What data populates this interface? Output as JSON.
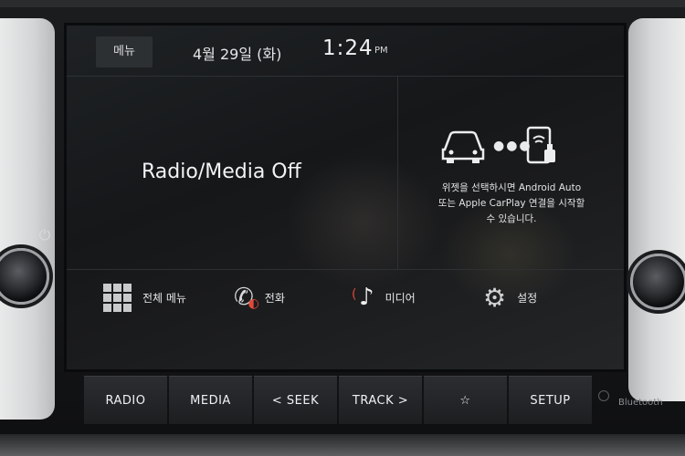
{
  "status_bar": {
    "menu_label": "메뉴",
    "date": "4월 29일 (화)",
    "time": "1:24",
    "ampm": "PM"
  },
  "main": {
    "radio_status": "Radio/Media Off",
    "connect_message_line1": "위젯을 선택하시면 Android Auto",
    "connect_message_line2": "또는 Apple CarPlay 연결을 시작할",
    "connect_message_line3": "수 있습니다."
  },
  "shortcuts": [
    {
      "label": "전체 메뉴",
      "icon": "grid-icon"
    },
    {
      "label": "전화",
      "icon": "phone-icon"
    },
    {
      "label": "미디어",
      "icon": "music-note-icon"
    },
    {
      "label": "설정",
      "icon": "gear-icon"
    }
  ],
  "hardware_buttons": [
    {
      "label": "RADIO"
    },
    {
      "label": "MEDIA"
    },
    {
      "label": "< SEEK"
    },
    {
      "label": "TRACK >"
    },
    {
      "label": "☆"
    },
    {
      "label": "SETUP"
    }
  ],
  "bluetooth_label": "Bluetooth",
  "colors": {
    "accent_red": "#e2483a",
    "screen_bg": "#1a1c1e"
  }
}
